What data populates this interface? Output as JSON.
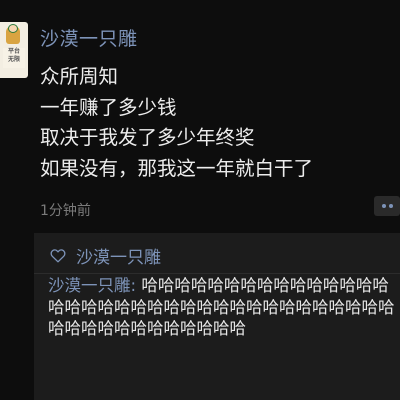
{
  "post": {
    "username": "沙漠一只雕",
    "avatar_badge": "平台\n无限",
    "lines": [
      "众所周知",
      "一年赚了多少钱",
      "取决于我发了多少年终奖",
      "如果没有，那我这一年就白干了"
    ],
    "time": "1分钟前"
  },
  "interaction": {
    "likers": "沙漠一只雕",
    "comment": {
      "author": "沙漠一只雕: ",
      "text": "哈哈哈哈哈哈哈哈哈哈哈哈哈哈哈哈哈哈哈哈哈哈哈哈哈哈哈哈哈哈哈哈哈哈哈哈哈哈哈哈哈哈哈哈哈哈哈哈"
    }
  },
  "colors": {
    "background": "#0d0d0d",
    "name_link": "#7d93b8",
    "text": "#ededed",
    "muted": "#7a7a7a",
    "panel": "#1c1c1c"
  },
  "icons": {
    "like": "heart-outline-icon",
    "more": "more-dots-icon"
  }
}
